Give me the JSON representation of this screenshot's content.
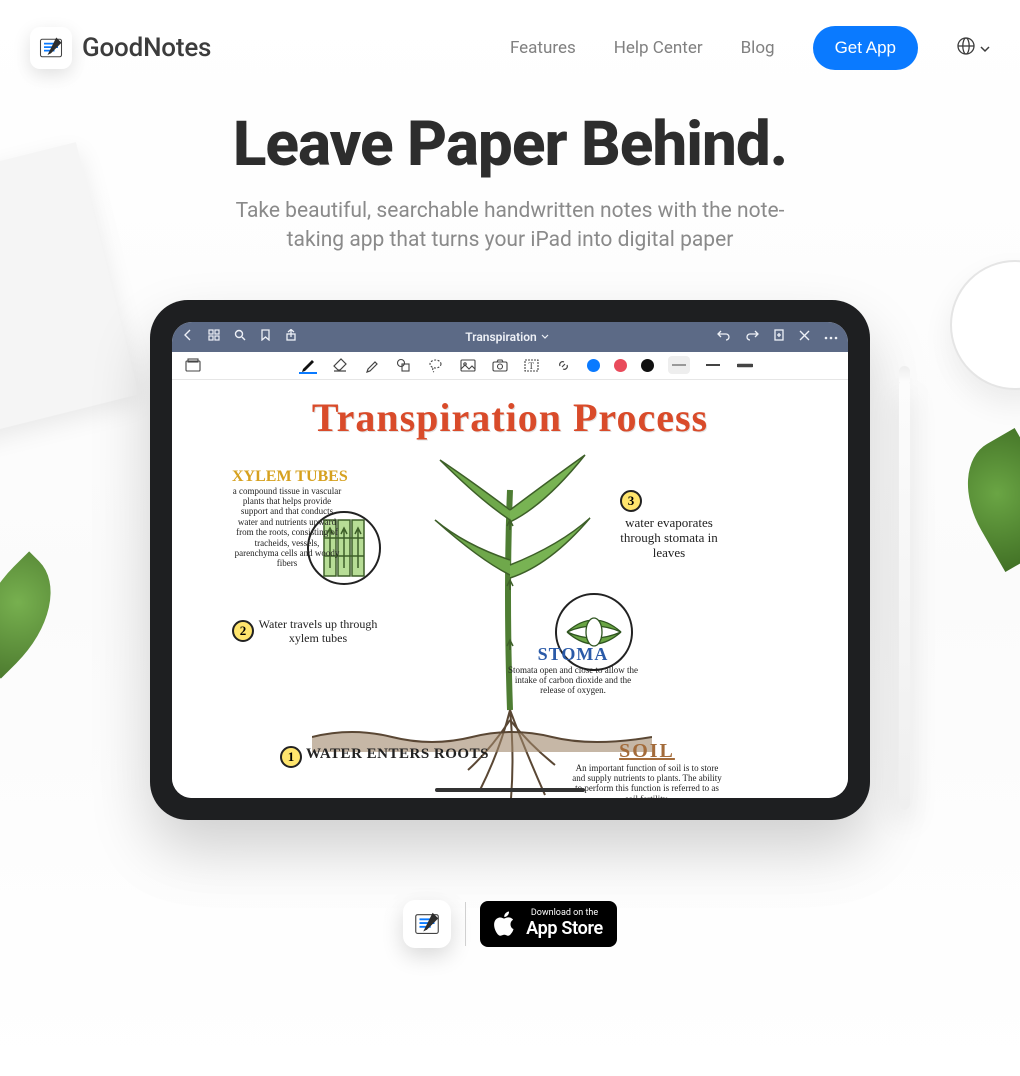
{
  "header": {
    "brand": "GoodNotes",
    "nav": [
      "Features",
      "Help Center",
      "Blog"
    ],
    "cta": "Get App"
  },
  "hero": {
    "headline": "Leave Paper Behind.",
    "subhead": "Take beautiful, searchable handwritten notes with the note-taking app that turns your iPad into digital paper"
  },
  "app": {
    "doc_title": "Transpiration",
    "colors": [
      "background:#0a7aff",
      "background:#e94b5b",
      "background:#111"
    ]
  },
  "note": {
    "title": "Transpiration Process",
    "annotations": [
      {
        "heading": "XYLEM TUBES",
        "body": "a compound tissue in vascular plants that helps provide support and that conducts water and nutrients upward from the roots, consisting of tracheids, vessels, parenchyma cells and woody fibers"
      },
      {
        "heading": "STOMA",
        "body": "Stomata open and close to allow the intake of carbon dioxide and the release of oxygen."
      },
      {
        "heading": "SOIL",
        "body": "An important function of soil is to store and supply nutrients to plants. The ability to perform this function is referred to as soil fertility."
      }
    ],
    "steps": [
      {
        "num": "1",
        "text": "water enters roots"
      },
      {
        "num": "2",
        "text": "Water travels up through xylem tubes"
      },
      {
        "num": "3",
        "text": "water evaporates through stomata in leaves"
      }
    ]
  },
  "download": {
    "pre": "Download on the",
    "title": "App Store"
  }
}
